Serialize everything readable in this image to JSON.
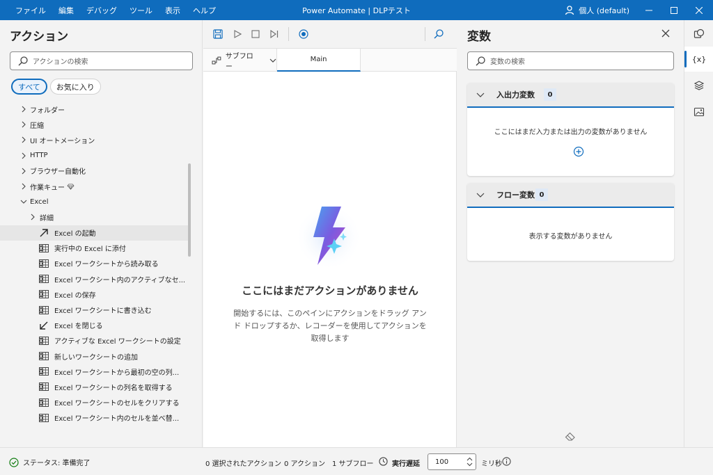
{
  "titlebar": {
    "menu": [
      "ファイル",
      "編集",
      "デバッグ",
      "ツール",
      "表示",
      "ヘルプ"
    ],
    "title": "Power Automate | DLPテスト",
    "account": "個人 (default)"
  },
  "actions_panel": {
    "title": "アクション",
    "search_placeholder": "アクションの検索",
    "filters": [
      "すべて",
      "お気に入り"
    ],
    "tree": [
      {
        "label": "フォルダー",
        "type": "group"
      },
      {
        "label": "圧縮",
        "type": "group"
      },
      {
        "label": "UI オートメーション",
        "type": "group"
      },
      {
        "label": "HTTP",
        "type": "group"
      },
      {
        "label": "ブラウザー自動化",
        "type": "group"
      },
      {
        "label": "作業キュー",
        "type": "group-premium"
      },
      {
        "label": "Excel",
        "type": "group-open"
      },
      {
        "label": "詳細",
        "type": "subgroup"
      },
      {
        "label": "Excel の起動",
        "type": "launch"
      },
      {
        "label": "実行中の Excel に添付",
        "type": "action"
      },
      {
        "label": "Excel ワークシートから読み取る",
        "type": "action"
      },
      {
        "label": "Excel ワークシート内のアクティブなセ...",
        "type": "action"
      },
      {
        "label": "Excel の保存",
        "type": "action"
      },
      {
        "label": "Excel ワークシートに書き込む",
        "type": "action"
      },
      {
        "label": "Excel を閉じる",
        "type": "close"
      },
      {
        "label": "アクティブな Excel ワークシートの設定",
        "type": "action"
      },
      {
        "label": "新しいワークシートの追加",
        "type": "action"
      },
      {
        "label": "Excel ワークシートから最初の空の列...",
        "type": "action"
      },
      {
        "label": "Excel ワークシートの列名を取得する",
        "type": "action"
      },
      {
        "label": "Excel ワークシートのセルをクリアする",
        "type": "action"
      },
      {
        "label": "Excel ワークシート内のセルを並べ替...",
        "type": "action"
      }
    ]
  },
  "designer": {
    "subflow_label": "サブフロー",
    "tab_main": "Main",
    "empty_title": "ここにはまだアクションがありません",
    "empty_desc": "開始するには、このペインにアクションをドラッグ アンド ドロップするか、レコーダーを使用してアクションを取得します"
  },
  "variables_panel": {
    "title": "変数",
    "search_placeholder": "変数の検索",
    "io_title": "入出力変数",
    "io_count": "0",
    "io_empty": "ここにはまだ入力または出力の変数がありません",
    "flow_title": "フロー変数",
    "flow_count": "0",
    "flow_empty": "表示する変数がありません"
  },
  "rail": {
    "vars_label": "{x}"
  },
  "statusbar": {
    "status": "ステータス: 準備完了",
    "selected": "0 選択されたアクション",
    "actions": "0 アクション",
    "subflows": "1 サブフロー",
    "delay_label": "実行遅延",
    "delay_value": "100",
    "unit": "ミリ秒"
  },
  "colors": {
    "accent": "#0f6cbd",
    "titlebar": "#0f6cbd",
    "success": "#107c10"
  }
}
